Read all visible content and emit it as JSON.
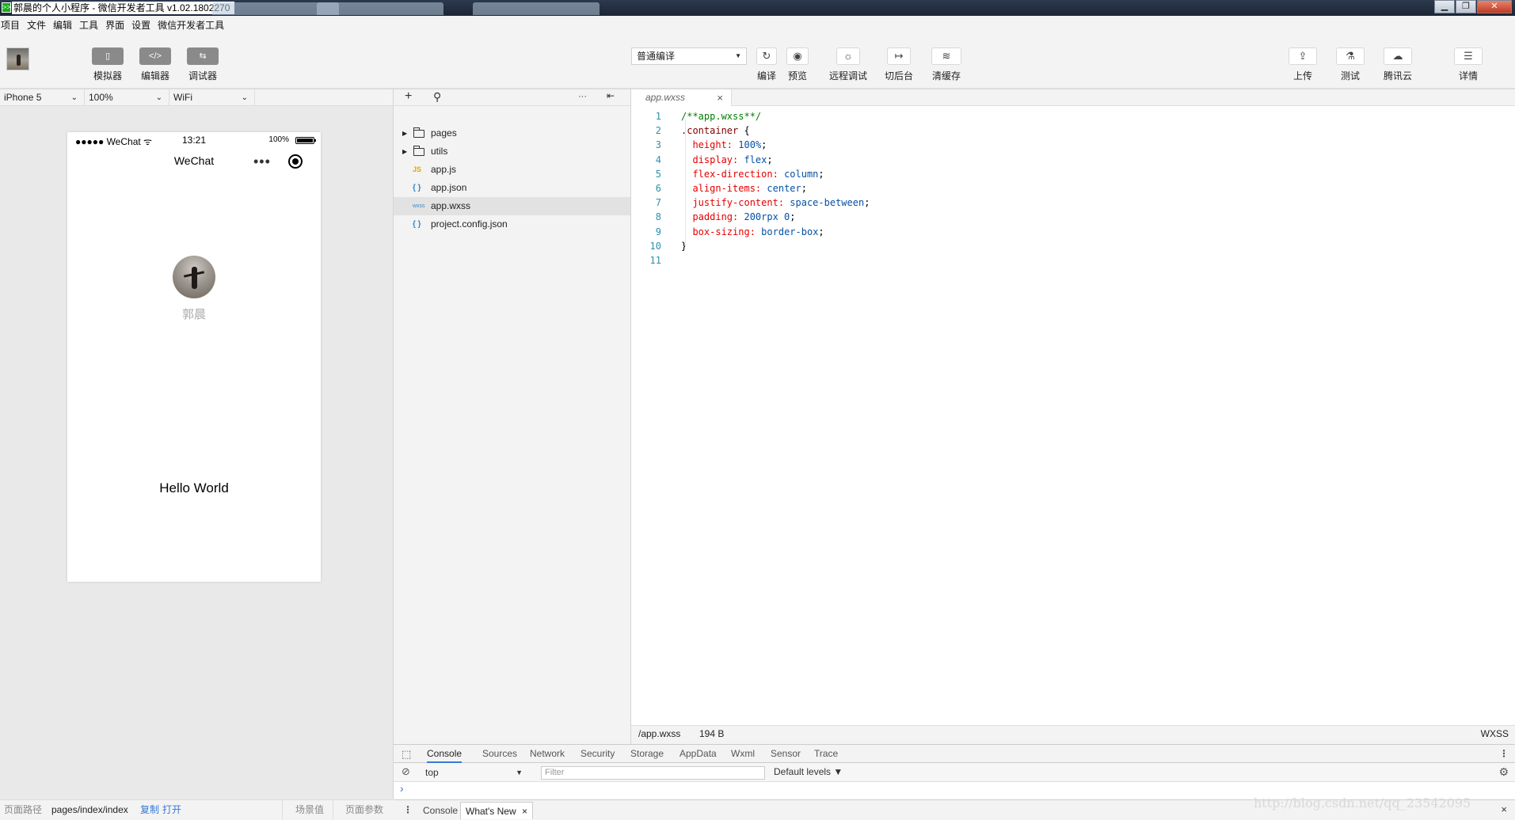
{
  "window": {
    "title": "郭晨的个人小程序 - 微信开发者工具 v1.02.1802270",
    "app_icon_glyph": ">>",
    "buttons": {
      "minimize": "▁",
      "maximize": "❐",
      "close": "✕"
    }
  },
  "menu": [
    "项目",
    "文件",
    "编辑",
    "工具",
    "界面",
    "设置",
    "微信开发者工具"
  ],
  "toolbar": {
    "left_buttons": [
      {
        "label": "模拟器",
        "icon": "phone-icon",
        "glyph": "▯"
      },
      {
        "label": "编辑器",
        "icon": "code-icon",
        "glyph": "</>"
      },
      {
        "label": "调试器",
        "icon": "debug-icon",
        "glyph": "⇆"
      }
    ],
    "compile_mode": "普通编译",
    "center_buttons": [
      {
        "label": "编译",
        "icon": "refresh-icon",
        "glyph": "↻"
      },
      {
        "label": "预览",
        "icon": "eye-icon",
        "glyph": "◉"
      },
      {
        "label": "远程调试",
        "icon": "bug-icon",
        "glyph": "☼"
      },
      {
        "label": "切后台",
        "icon": "background-icon",
        "glyph": "↦"
      },
      {
        "label": "清缓存",
        "icon": "layers-icon",
        "glyph": "≋"
      }
    ],
    "right_buttons": [
      {
        "label": "上传",
        "icon": "upload-icon",
        "glyph": "⇪"
      },
      {
        "label": "测试",
        "icon": "flask-icon",
        "glyph": "⚗"
      },
      {
        "label": "腾讯云",
        "icon": "cloud-icon",
        "glyph": "☁"
      },
      {
        "label": "详情",
        "icon": "menu-icon",
        "glyph": "☰"
      }
    ]
  },
  "simulator": {
    "device": "iPhone 5",
    "zoom": "100%",
    "network": "WiFi",
    "status_bar": {
      "carrier": "●●●●● WeChat ᯤ",
      "time": "13:21",
      "battery": "100%"
    },
    "nav_title": "WeChat",
    "capsule_more": "•••",
    "nickname": "郭晨",
    "hello_text": "Hello World"
  },
  "file_tree": [
    {
      "name": "pages",
      "type": "folder"
    },
    {
      "name": "utils",
      "type": "folder"
    },
    {
      "name": "app.js",
      "type": "js",
      "badge": "JS"
    },
    {
      "name": "app.json",
      "type": "json",
      "badge": "{ }"
    },
    {
      "name": "app.wxss",
      "type": "wxss",
      "badge": "wxss",
      "selected": true
    },
    {
      "name": "project.config.json",
      "type": "json",
      "badge": "{ }"
    }
  ],
  "tree_header": {
    "add": "+",
    "search": "⚲",
    "more": "···",
    "collapse": "⇤"
  },
  "editor": {
    "tab_name": "app.wxss",
    "tab_close": "×",
    "lines": [
      {
        "n": "1",
        "parts": [
          [
            "comment",
            "/**app.wxss**/"
          ]
        ]
      },
      {
        "n": "2",
        "parts": [
          [
            "sel",
            ".container "
          ],
          [
            "punc",
            "{"
          ]
        ]
      },
      {
        "n": "3",
        "parts": [
          [
            "punc",
            "  "
          ],
          [
            "prop",
            "height:"
          ],
          [
            "punc",
            " "
          ],
          [
            "val",
            "100%"
          ],
          [
            "punc",
            ";"
          ]
        ]
      },
      {
        "n": "4",
        "parts": [
          [
            "punc",
            "  "
          ],
          [
            "prop",
            "display:"
          ],
          [
            "punc",
            " "
          ],
          [
            "val",
            "flex"
          ],
          [
            "punc",
            ";"
          ]
        ]
      },
      {
        "n": "5",
        "parts": [
          [
            "punc",
            "  "
          ],
          [
            "prop",
            "flex-direction:"
          ],
          [
            "punc",
            " "
          ],
          [
            "val",
            "column"
          ],
          [
            "punc",
            ";"
          ]
        ]
      },
      {
        "n": "6",
        "parts": [
          [
            "punc",
            "  "
          ],
          [
            "prop",
            "align-items:"
          ],
          [
            "punc",
            " "
          ],
          [
            "val",
            "center"
          ],
          [
            "punc",
            ";"
          ]
        ]
      },
      {
        "n": "7",
        "parts": [
          [
            "punc",
            "  "
          ],
          [
            "prop",
            "justify-content:"
          ],
          [
            "punc",
            " "
          ],
          [
            "val",
            "space-between"
          ],
          [
            "punc",
            ";"
          ]
        ]
      },
      {
        "n": "8",
        "parts": [
          [
            "punc",
            "  "
          ],
          [
            "prop",
            "padding:"
          ],
          [
            "punc",
            " "
          ],
          [
            "val",
            "200rpx 0"
          ],
          [
            "punc",
            ";"
          ]
        ]
      },
      {
        "n": "9",
        "parts": [
          [
            "punc",
            "  "
          ],
          [
            "prop",
            "box-sizing:"
          ],
          [
            "punc",
            " "
          ],
          [
            "val",
            "border-box"
          ],
          [
            "punc",
            ";"
          ]
        ]
      },
      {
        "n": "10",
        "parts": [
          [
            "punc",
            "}"
          ]
        ]
      },
      {
        "n": "11",
        "parts": []
      }
    ],
    "status_path": "/app.wxss",
    "status_size": "194 B",
    "status_lang": "WXSS"
  },
  "devtools": {
    "tabs": [
      "Console",
      "Sources",
      "Network",
      "Security",
      "Storage",
      "AppData",
      "Wxml",
      "Sensor",
      "Trace"
    ],
    "active_tab": "Console",
    "context": "top",
    "filter_placeholder": "Filter",
    "levels": "Default levels ▼",
    "prompt": "›",
    "drawer_tabs": [
      "Console",
      "What's New"
    ],
    "drawer_close": "×"
  },
  "bottom_bar": {
    "path_label": "页面路径",
    "path_value": "pages/index/index",
    "copy": "复制",
    "open": "打开",
    "scene_label": "场景值",
    "params_label": "页面参数"
  },
  "watermark": "http://blog.csdn.net/qq_23542095",
  "colors": {
    "accent": "#3879d9",
    "wechat_green": "#1aad19",
    "line_number": "#2b91af"
  }
}
